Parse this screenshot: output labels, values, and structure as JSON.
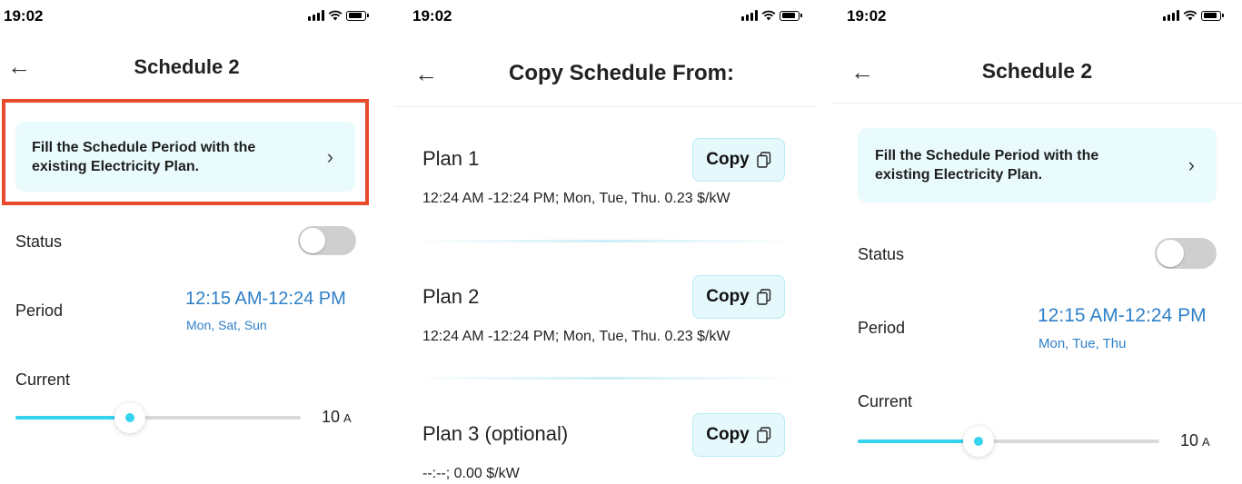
{
  "screens": [
    {
      "time": "19:02",
      "title": "Schedule 2",
      "fill_card_text": "Fill the Schedule Period with the existing Electricity Plan.",
      "status_label": "Status",
      "status_on": false,
      "period_label": "Period",
      "period_time": "12:15 AM-12:24 PM",
      "period_days": "Mon, Sat, Sun",
      "current_label": "Current",
      "current_value": "10",
      "current_unit": "A",
      "current_slider_fraction": 0.4,
      "highlight_color": "#e84a2c"
    },
    {
      "time": "19:02",
      "title": "Copy Schedule From:",
      "copy_label": "Copy",
      "plans": [
        {
          "name": "Plan 1",
          "detail": "12:24 AM -12:24 PM; Mon, Tue, Thu. 0.23 $/kW"
        },
        {
          "name": "Plan 2",
          "detail": "12:24 AM -12:24 PM; Mon, Tue, Thu. 0.23 $/kW"
        },
        {
          "name": "Plan 3 (optional)",
          "detail": "--:--; 0.00 $/kW"
        }
      ]
    },
    {
      "time": "19:02",
      "title": "Schedule 2",
      "fill_card_text": "Fill the Schedule Period with the existing Electricity Plan.",
      "status_label": "Status",
      "status_on": false,
      "period_label": "Period",
      "period_time": "12:15 AM-12:24 PM",
      "period_days": "Mon, Tue, Thu",
      "current_label": "Current",
      "current_value": "10",
      "current_unit": "A",
      "current_slider_fraction": 0.4
    }
  ],
  "colors": {
    "accent_cyan": "#35d3ee",
    "link_blue": "#2f80c8",
    "card_bg": "#e9fbfd"
  },
  "icons": {
    "back": "arrow-left-icon",
    "chevron": "chevron-right-icon",
    "copy": "copy-icon",
    "signal": "signal-icon",
    "wifi": "wifi-icon",
    "battery": "battery-icon"
  }
}
